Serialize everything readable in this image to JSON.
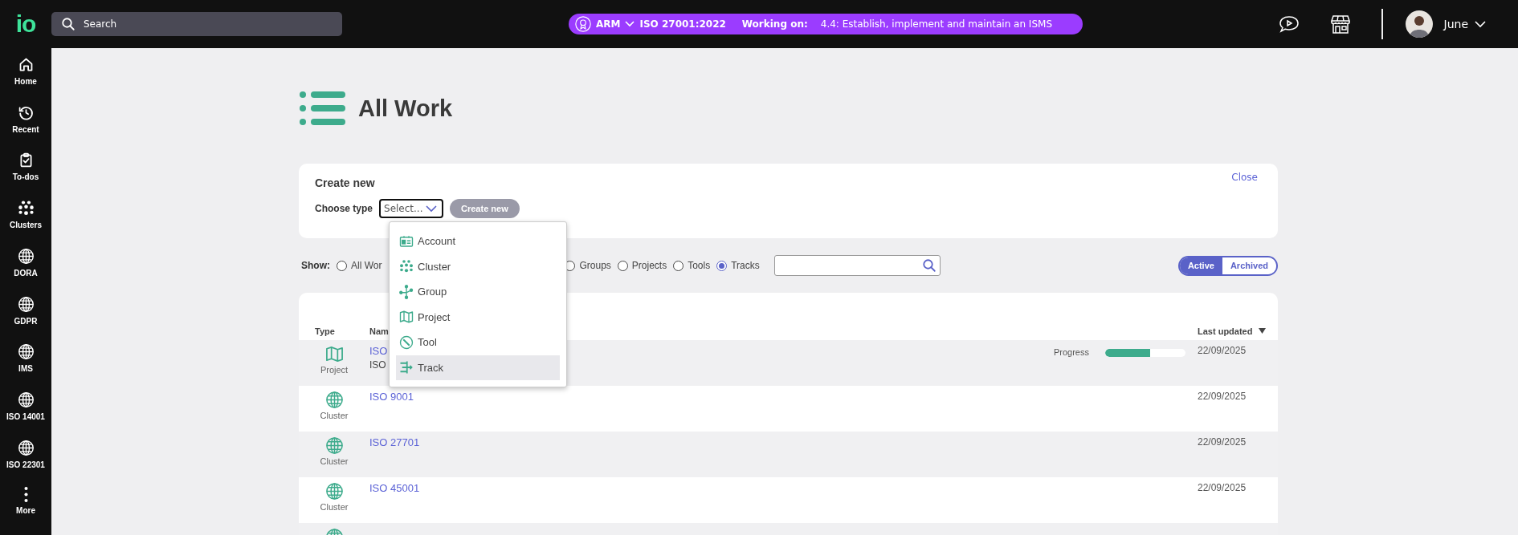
{
  "top_bar": {
    "logo": "io",
    "search": {
      "placeholder": "Search"
    },
    "context": {
      "org": "ARM",
      "standard": "ISO 27001:2022",
      "working_on_label": "Working on:",
      "working_on": "4.4: Establish, implement and maintain an ISMS"
    },
    "user": {
      "name": "June"
    }
  },
  "sidebar": {
    "items": [
      {
        "label": "Home",
        "kind": "home"
      },
      {
        "label": "Recent",
        "kind": "recent"
      },
      {
        "label": "To-dos",
        "kind": "todos"
      },
      {
        "label": "Clusters",
        "kind": "clusters"
      },
      {
        "label": "DORA",
        "kind": "globe"
      },
      {
        "label": "GDPR",
        "kind": "globe"
      },
      {
        "label": "IMS",
        "kind": "globe"
      },
      {
        "label": "ISO 14001",
        "kind": "globe"
      },
      {
        "label": "ISO 22301",
        "kind": "globe"
      },
      {
        "label": "More",
        "kind": "more"
      }
    ]
  },
  "page": {
    "title": "All Work"
  },
  "create_new": {
    "title": "Create new",
    "close": "Close",
    "type_label": "Choose type",
    "select": {
      "value": "Select..."
    },
    "button": {
      "label": "Create new",
      "disabled": true
    },
    "menu": [
      {
        "label": "Account",
        "kind": "account",
        "selected": false
      },
      {
        "label": "Cluster",
        "kind": "cluster",
        "selected": false
      },
      {
        "label": "Group",
        "kind": "group",
        "selected": false
      },
      {
        "label": "Project",
        "kind": "project",
        "selected": false
      },
      {
        "label": "Tool",
        "kind": "tool",
        "selected": false
      },
      {
        "label": "Track",
        "kind": "track",
        "selected": true
      }
    ]
  },
  "filter": {
    "label": "Show:",
    "options": [
      {
        "label": "All Wor",
        "selected": false
      },
      {
        "label": "Groups",
        "selected": false
      },
      {
        "label": "Projects",
        "selected": false
      },
      {
        "label": "Tools",
        "selected": false
      },
      {
        "label": "Tracks",
        "selected": true
      }
    ],
    "toggle": [
      {
        "label": "Active",
        "selected": true
      },
      {
        "label": "Archived",
        "selected": false
      }
    ]
  },
  "table": {
    "columns": [
      "Type",
      "Nam",
      "Last updated"
    ],
    "rows": [
      {
        "type": "Project",
        "kind": "project",
        "name": "ISO",
        "subtitle": "ISO",
        "progress_label": "Progress",
        "level": 0.56,
        "updated": "22/09/2025"
      },
      {
        "type": "Cluster",
        "kind": "cluster",
        "name": "ISO 9001",
        "updated": "22/09/2025"
      },
      {
        "type": "Cluster",
        "kind": "cluster",
        "name": "ISO 27701",
        "updated": "22/09/2025"
      },
      {
        "type": "Cluster",
        "kind": "cluster",
        "name": "ISO 45001",
        "updated": "22/09/2025"
      },
      {
        "kind": "cluster"
      }
    ]
  }
}
